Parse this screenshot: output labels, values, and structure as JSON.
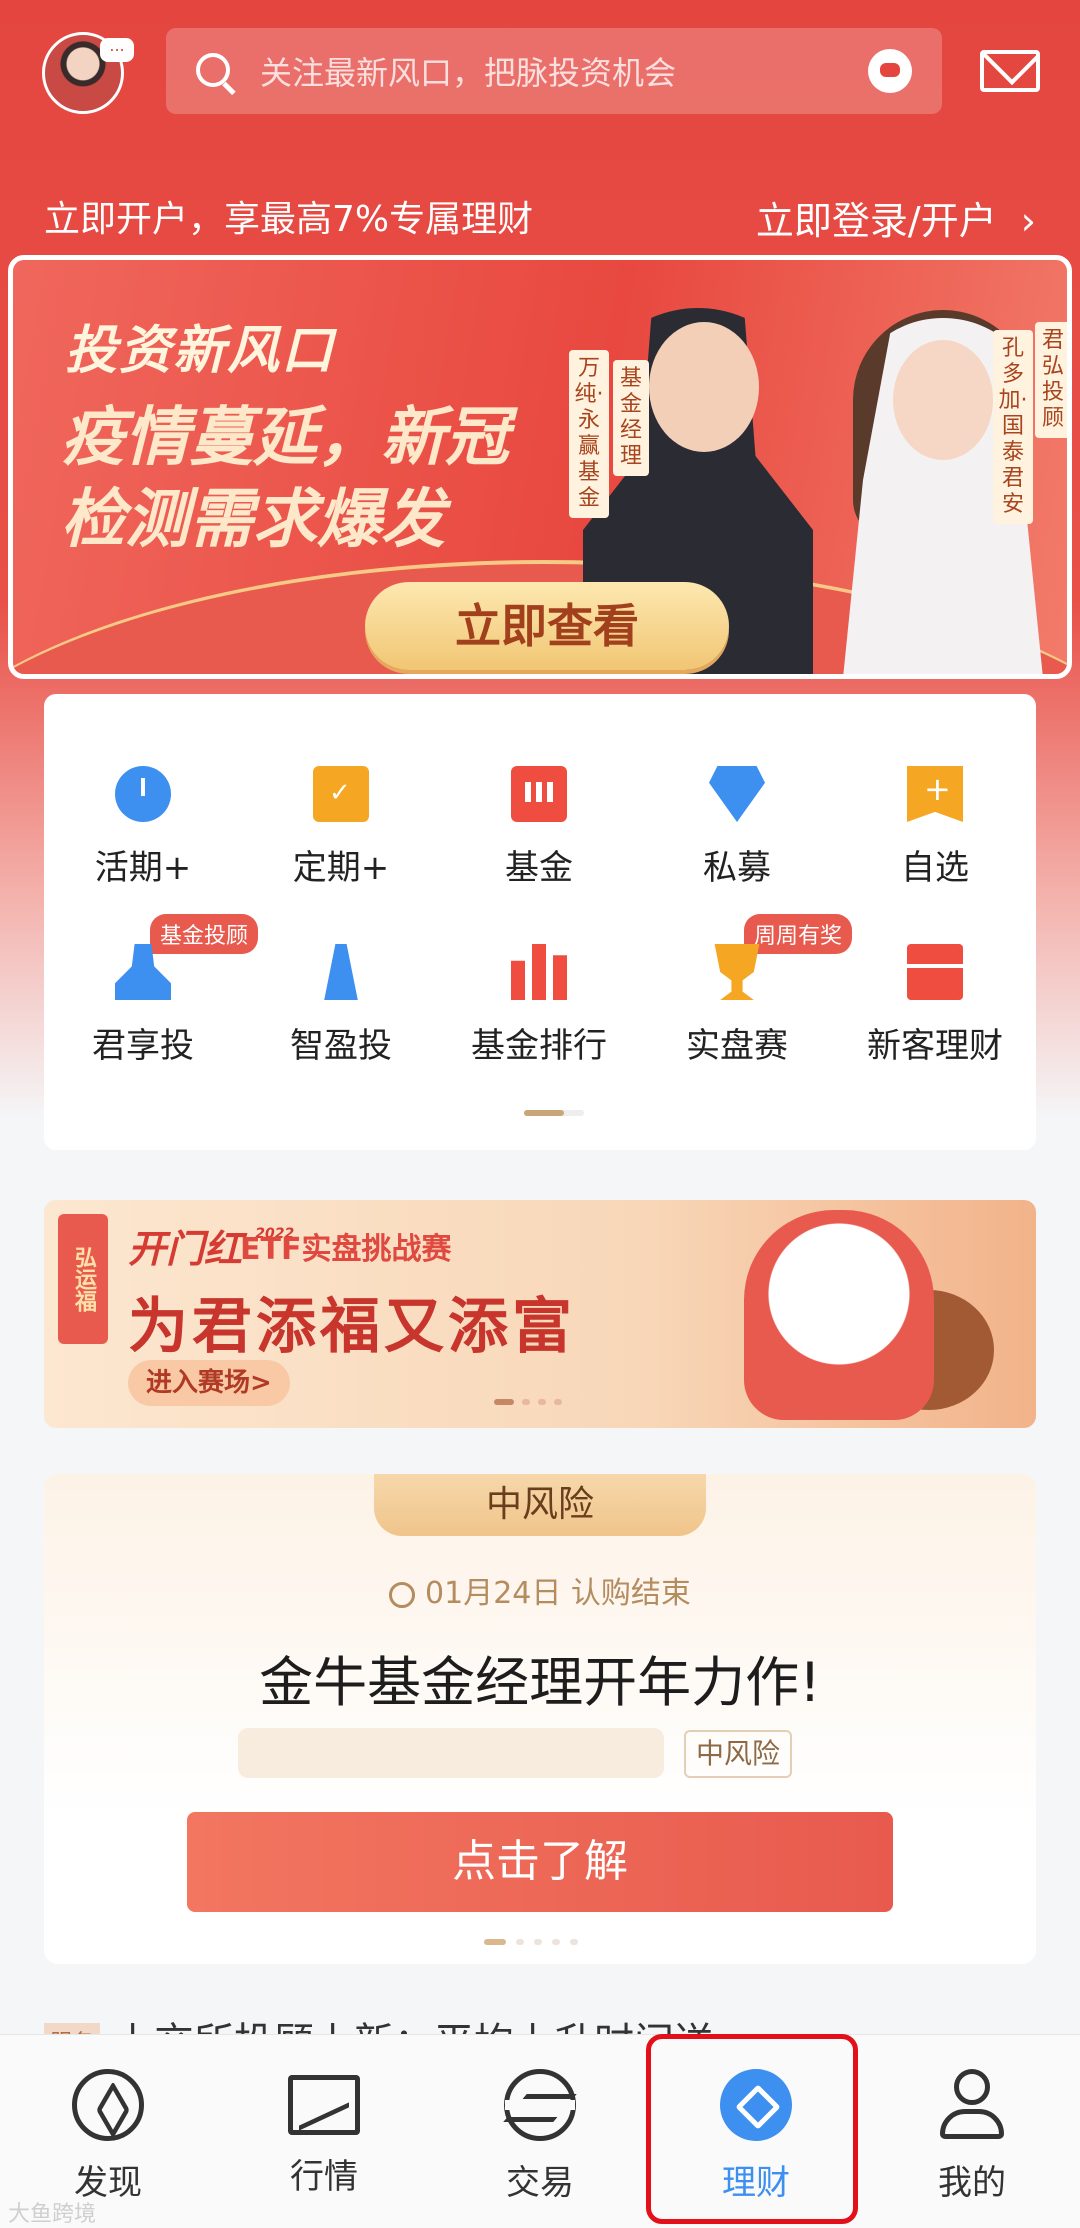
{
  "header": {
    "avatar_badge": "...",
    "search_placeholder": "关注最新风口，把脉投资机会",
    "icons": [
      "search-icon",
      "customer-service-icon",
      "mail-icon"
    ]
  },
  "promo": {
    "left": "立即开户，享最高7%专属理财",
    "right": "立即登录/开户",
    "right_arrow": "›"
  },
  "banner": {
    "kicker": "投资新风口",
    "line1": "疫情蔓延，新冠",
    "line2": "检测需求爆发",
    "man_role": "基金经理",
    "man_name": "万纯·永赢基金",
    "woman_role": "君弘投顾",
    "woman_name": "孔多加·国泰君安",
    "button": "立即查看"
  },
  "grid": {
    "items": [
      {
        "label": "活期+",
        "icon": "clock-icon"
      },
      {
        "label": "定期+",
        "icon": "calendar-icon"
      },
      {
        "label": "基金",
        "icon": "fund-chart-icon"
      },
      {
        "label": "私募",
        "icon": "diamond-icon"
      },
      {
        "label": "自选",
        "icon": "bookmark-plus-icon"
      },
      {
        "label": "君享投",
        "icon": "advisor-icon",
        "badge": "基金投顾"
      },
      {
        "label": "智盈投",
        "icon": "tower-icon"
      },
      {
        "label": "基金排行",
        "icon": "ranking-icon"
      },
      {
        "label": "实盘赛",
        "icon": "trophy-icon",
        "badge": "周周有奖"
      },
      {
        "label": "新客理财",
        "icon": "gift-icon"
      }
    ]
  },
  "etf_banner": {
    "seal": "弘运福",
    "logo": "开门红",
    "year": "2022",
    "title": "ETF实盘挑战赛",
    "main": "为君添福又添富",
    "button": "进入赛场>"
  },
  "product": {
    "risk_tab": "中风险",
    "date": "01月24日 认购结束",
    "title": "金牛基金经理开年力作!",
    "risk_tag": "中风险",
    "button": "点击了解"
  },
  "peek": {
    "tag": "服务",
    "text": "上交所投顾上新：平均上升时间送"
  },
  "nav": {
    "items": [
      {
        "label": "发现",
        "icon": "compass-icon"
      },
      {
        "label": "行情",
        "icon": "chart-icon"
      },
      {
        "label": "交易",
        "icon": "trade-icon"
      },
      {
        "label": "理财",
        "icon": "finance-icon",
        "active": true
      },
      {
        "label": "我的",
        "icon": "profile-icon"
      }
    ]
  },
  "watermark": "大鱼跨境",
  "colors": {
    "brand_red": "#e4463f",
    "active_blue": "#3d8ff0",
    "gold": "#f1c674"
  }
}
